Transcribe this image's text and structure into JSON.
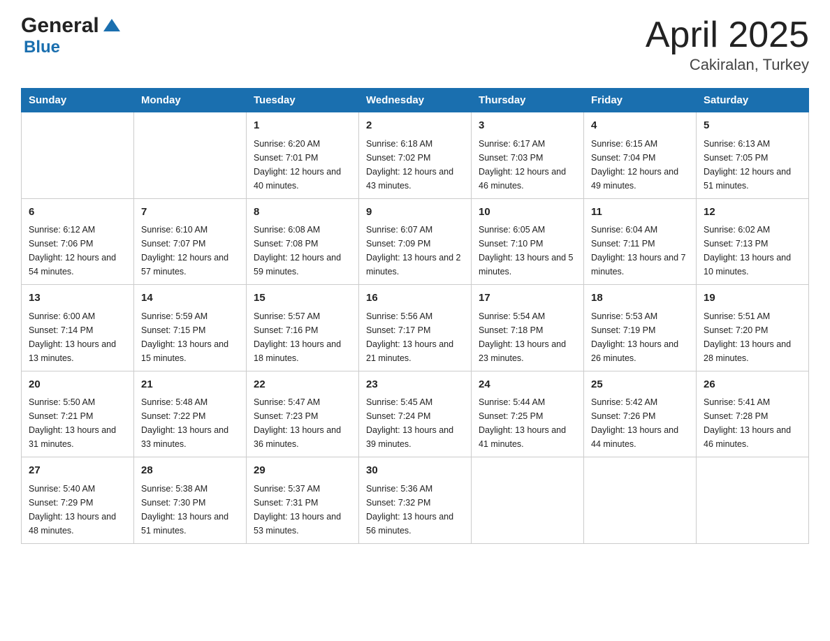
{
  "header": {
    "logo_general": "General",
    "logo_blue": "Blue",
    "title": "April 2025",
    "subtitle": "Cakiralan, Turkey"
  },
  "weekdays": [
    "Sunday",
    "Monday",
    "Tuesday",
    "Wednesday",
    "Thursday",
    "Friday",
    "Saturday"
  ],
  "weeks": [
    [
      {
        "day": "",
        "sunrise": "",
        "sunset": "",
        "daylight": ""
      },
      {
        "day": "",
        "sunrise": "",
        "sunset": "",
        "daylight": ""
      },
      {
        "day": "1",
        "sunrise": "Sunrise: 6:20 AM",
        "sunset": "Sunset: 7:01 PM",
        "daylight": "Daylight: 12 hours and 40 minutes."
      },
      {
        "day": "2",
        "sunrise": "Sunrise: 6:18 AM",
        "sunset": "Sunset: 7:02 PM",
        "daylight": "Daylight: 12 hours and 43 minutes."
      },
      {
        "day": "3",
        "sunrise": "Sunrise: 6:17 AM",
        "sunset": "Sunset: 7:03 PM",
        "daylight": "Daylight: 12 hours and 46 minutes."
      },
      {
        "day": "4",
        "sunrise": "Sunrise: 6:15 AM",
        "sunset": "Sunset: 7:04 PM",
        "daylight": "Daylight: 12 hours and 49 minutes."
      },
      {
        "day": "5",
        "sunrise": "Sunrise: 6:13 AM",
        "sunset": "Sunset: 7:05 PM",
        "daylight": "Daylight: 12 hours and 51 minutes."
      }
    ],
    [
      {
        "day": "6",
        "sunrise": "Sunrise: 6:12 AM",
        "sunset": "Sunset: 7:06 PM",
        "daylight": "Daylight: 12 hours and 54 minutes."
      },
      {
        "day": "7",
        "sunrise": "Sunrise: 6:10 AM",
        "sunset": "Sunset: 7:07 PM",
        "daylight": "Daylight: 12 hours and 57 minutes."
      },
      {
        "day": "8",
        "sunrise": "Sunrise: 6:08 AM",
        "sunset": "Sunset: 7:08 PM",
        "daylight": "Daylight: 12 hours and 59 minutes."
      },
      {
        "day": "9",
        "sunrise": "Sunrise: 6:07 AM",
        "sunset": "Sunset: 7:09 PM",
        "daylight": "Daylight: 13 hours and 2 minutes."
      },
      {
        "day": "10",
        "sunrise": "Sunrise: 6:05 AM",
        "sunset": "Sunset: 7:10 PM",
        "daylight": "Daylight: 13 hours and 5 minutes."
      },
      {
        "day": "11",
        "sunrise": "Sunrise: 6:04 AM",
        "sunset": "Sunset: 7:11 PM",
        "daylight": "Daylight: 13 hours and 7 minutes."
      },
      {
        "day": "12",
        "sunrise": "Sunrise: 6:02 AM",
        "sunset": "Sunset: 7:13 PM",
        "daylight": "Daylight: 13 hours and 10 minutes."
      }
    ],
    [
      {
        "day": "13",
        "sunrise": "Sunrise: 6:00 AM",
        "sunset": "Sunset: 7:14 PM",
        "daylight": "Daylight: 13 hours and 13 minutes."
      },
      {
        "day": "14",
        "sunrise": "Sunrise: 5:59 AM",
        "sunset": "Sunset: 7:15 PM",
        "daylight": "Daylight: 13 hours and 15 minutes."
      },
      {
        "day": "15",
        "sunrise": "Sunrise: 5:57 AM",
        "sunset": "Sunset: 7:16 PM",
        "daylight": "Daylight: 13 hours and 18 minutes."
      },
      {
        "day": "16",
        "sunrise": "Sunrise: 5:56 AM",
        "sunset": "Sunset: 7:17 PM",
        "daylight": "Daylight: 13 hours and 21 minutes."
      },
      {
        "day": "17",
        "sunrise": "Sunrise: 5:54 AM",
        "sunset": "Sunset: 7:18 PM",
        "daylight": "Daylight: 13 hours and 23 minutes."
      },
      {
        "day": "18",
        "sunrise": "Sunrise: 5:53 AM",
        "sunset": "Sunset: 7:19 PM",
        "daylight": "Daylight: 13 hours and 26 minutes."
      },
      {
        "day": "19",
        "sunrise": "Sunrise: 5:51 AM",
        "sunset": "Sunset: 7:20 PM",
        "daylight": "Daylight: 13 hours and 28 minutes."
      }
    ],
    [
      {
        "day": "20",
        "sunrise": "Sunrise: 5:50 AM",
        "sunset": "Sunset: 7:21 PM",
        "daylight": "Daylight: 13 hours and 31 minutes."
      },
      {
        "day": "21",
        "sunrise": "Sunrise: 5:48 AM",
        "sunset": "Sunset: 7:22 PM",
        "daylight": "Daylight: 13 hours and 33 minutes."
      },
      {
        "day": "22",
        "sunrise": "Sunrise: 5:47 AM",
        "sunset": "Sunset: 7:23 PM",
        "daylight": "Daylight: 13 hours and 36 minutes."
      },
      {
        "day": "23",
        "sunrise": "Sunrise: 5:45 AM",
        "sunset": "Sunset: 7:24 PM",
        "daylight": "Daylight: 13 hours and 39 minutes."
      },
      {
        "day": "24",
        "sunrise": "Sunrise: 5:44 AM",
        "sunset": "Sunset: 7:25 PM",
        "daylight": "Daylight: 13 hours and 41 minutes."
      },
      {
        "day": "25",
        "sunrise": "Sunrise: 5:42 AM",
        "sunset": "Sunset: 7:26 PM",
        "daylight": "Daylight: 13 hours and 44 minutes."
      },
      {
        "day": "26",
        "sunrise": "Sunrise: 5:41 AM",
        "sunset": "Sunset: 7:28 PM",
        "daylight": "Daylight: 13 hours and 46 minutes."
      }
    ],
    [
      {
        "day": "27",
        "sunrise": "Sunrise: 5:40 AM",
        "sunset": "Sunset: 7:29 PM",
        "daylight": "Daylight: 13 hours and 48 minutes."
      },
      {
        "day": "28",
        "sunrise": "Sunrise: 5:38 AM",
        "sunset": "Sunset: 7:30 PM",
        "daylight": "Daylight: 13 hours and 51 minutes."
      },
      {
        "day": "29",
        "sunrise": "Sunrise: 5:37 AM",
        "sunset": "Sunset: 7:31 PM",
        "daylight": "Daylight: 13 hours and 53 minutes."
      },
      {
        "day": "30",
        "sunrise": "Sunrise: 5:36 AM",
        "sunset": "Sunset: 7:32 PM",
        "daylight": "Daylight: 13 hours and 56 minutes."
      },
      {
        "day": "",
        "sunrise": "",
        "sunset": "",
        "daylight": ""
      },
      {
        "day": "",
        "sunrise": "",
        "sunset": "",
        "daylight": ""
      },
      {
        "day": "",
        "sunrise": "",
        "sunset": "",
        "daylight": ""
      }
    ]
  ]
}
